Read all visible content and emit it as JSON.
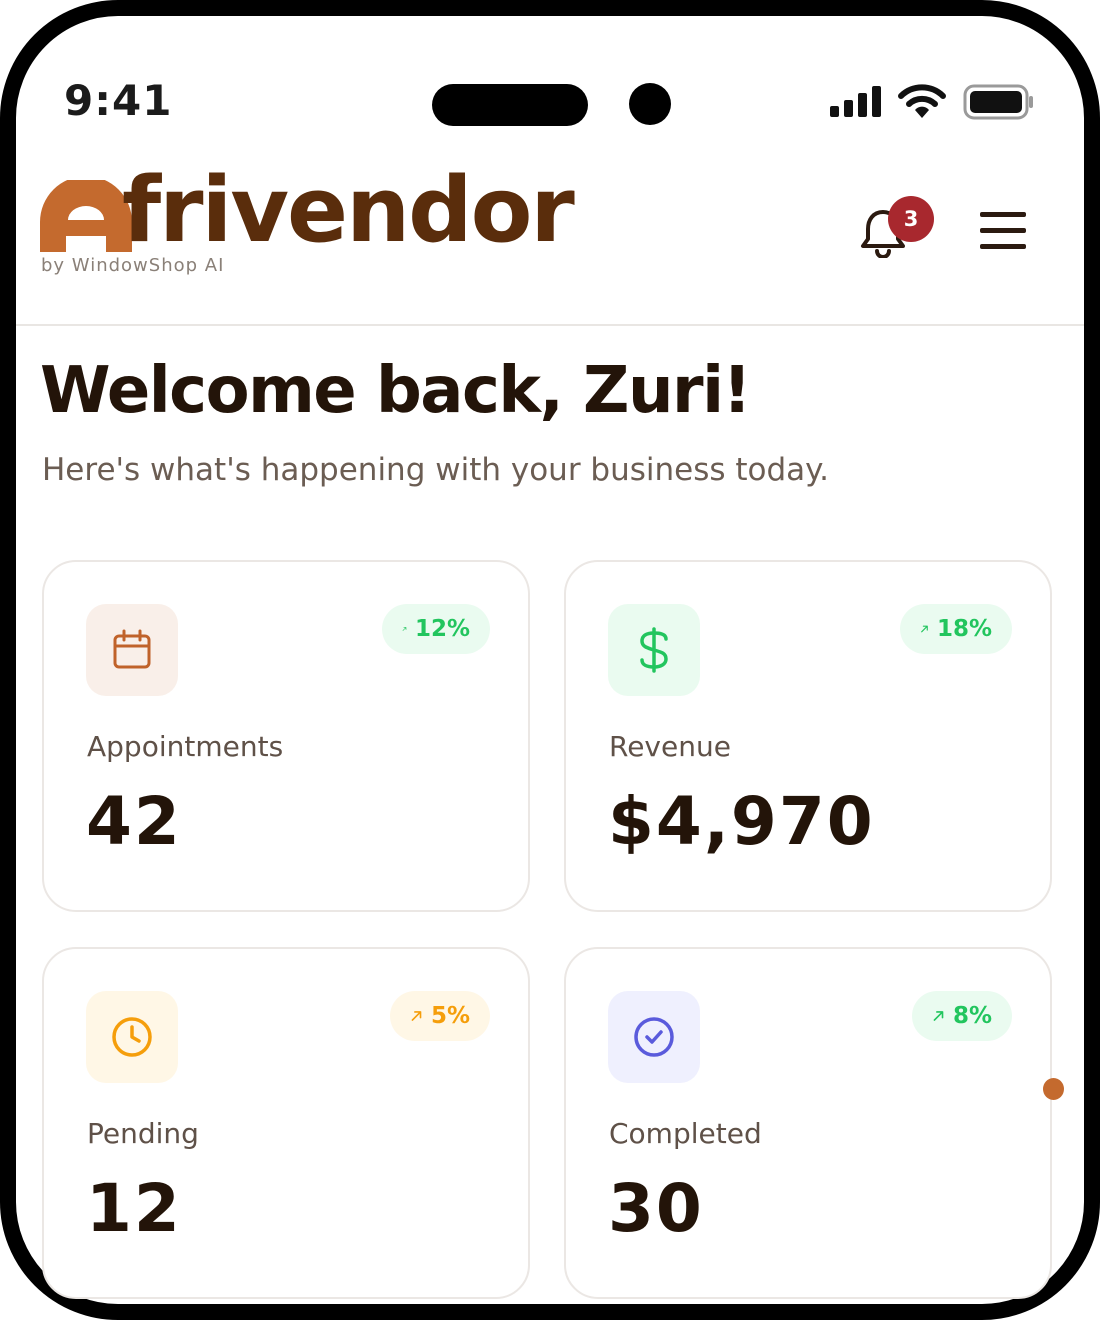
{
  "status_bar": {
    "time": "9:41"
  },
  "header": {
    "logo_word": "frivendor",
    "logo_tagline": "by WindowShop AI",
    "notification_count": "3"
  },
  "welcome": {
    "title": "Welcome back, Zuri!",
    "subtitle": "Here's what's happening with your business today."
  },
  "stats": [
    {
      "label": "Appointments",
      "value": "42",
      "trend": "12%",
      "icon": "calendar-icon",
      "icon_color": "#c0622a",
      "icon_bg": "#f9efe9",
      "trend_color": "#22c55e",
      "trend_bg": "#eafbf0"
    },
    {
      "label": "Revenue",
      "value": "$4,970",
      "trend": "18%",
      "icon": "dollar-icon",
      "icon_color": "#22c55e",
      "icon_bg": "#eafbf0",
      "trend_color": "#22c55e",
      "trend_bg": "#eafbf0"
    },
    {
      "label": "Pending",
      "value": "12",
      "trend": "5%",
      "icon": "clock-icon",
      "icon_color": "#f59e0b",
      "icon_bg": "#fff7e6",
      "trend_color": "#f59e0b",
      "trend_bg": "#fff7e6"
    },
    {
      "label": "Completed",
      "value": "30",
      "trend": "8%",
      "icon": "check-circle-icon",
      "icon_color": "#5a5bdc",
      "icon_bg": "#eff0fe",
      "trend_color": "#22c55e",
      "trend_bg": "#eafbf0"
    }
  ],
  "colors": {
    "brand_dark": "#5a2d0c",
    "brand_accent": "#c46a2e",
    "badge": "#a8282e"
  }
}
